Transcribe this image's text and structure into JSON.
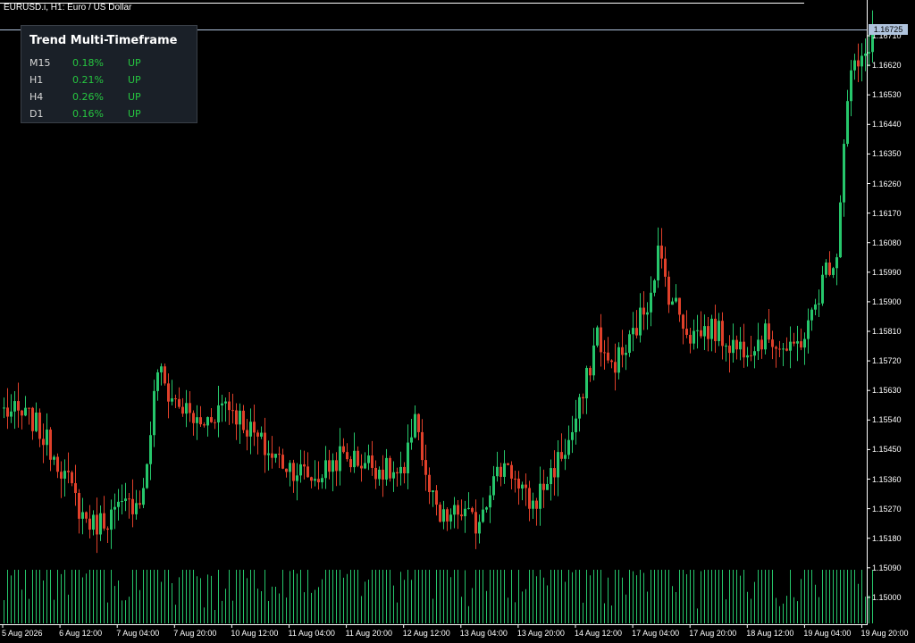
{
  "window": {
    "symbol_title": "EURUSD.i, H1:  Euro / US Dollar"
  },
  "trend_panel": {
    "title": "Trend Multi-Timeframe",
    "rows": [
      {
        "tf": "M15",
        "pct": "0.18%",
        "dir": "UP"
      },
      {
        "tf": "H1",
        "pct": "0.21%",
        "dir": "UP"
      },
      {
        "tf": "H4",
        "pct": "0.26%",
        "dir": "UP"
      },
      {
        "tf": "D1",
        "pct": "0.16%",
        "dir": "UP"
      }
    ]
  },
  "price_axis": {
    "labels": [
      "1.16710",
      "1.16620",
      "1.16530",
      "1.16440",
      "1.16350",
      "1.16260",
      "1.16170",
      "1.16080",
      "1.15990",
      "1.15900",
      "1.15810",
      "1.15720",
      "1.15630",
      "1.15540",
      "1.15450",
      "1.15360",
      "1.15270",
      "1.15180",
      "1.15090",
      "1.15000"
    ],
    "bid_label": "1.16725"
  },
  "time_axis": {
    "labels": [
      "5 Aug 2026",
      "6 Aug 12:00",
      "7 Aug 04:00",
      "7 Aug 20:00",
      "10 Aug 12:00",
      "11 Aug 04:00",
      "11 Aug 20:00",
      "12 Aug 12:00",
      "13 Aug 04:00",
      "13 Aug 20:00",
      "14 Aug 12:00",
      "17 Aug 04:00",
      "17 Aug 20:00",
      "18 Aug 12:00",
      "19 Aug 04:00",
      "19 Aug 20:00"
    ]
  },
  "colors": {
    "bull": "#26c66b",
    "bear": "#e0402a",
    "volume": "#26c66b",
    "bid_line": "#b0c4de",
    "text": "#ffffff",
    "up_text": "#26c640"
  },
  "chart_data": {
    "type": "candlestick",
    "symbol": "EURUSD.i",
    "timeframe": "H1",
    "ylim": [
      1.149,
      1.168
    ],
    "anchors": [
      {
        "bar": 0,
        "price": 1.1557
      },
      {
        "bar": 8,
        "price": 1.1554
      },
      {
        "bar": 15,
        "price": 1.1542
      },
      {
        "bar": 22,
        "price": 1.1525
      },
      {
        "bar": 25,
        "price": 1.1522
      },
      {
        "bar": 35,
        "price": 1.1528
      },
      {
        "bar": 39,
        "price": 1.1532
      },
      {
        "bar": 43,
        "price": 1.157
      },
      {
        "bar": 46,
        "price": 1.1562
      },
      {
        "bar": 55,
        "price": 1.1552
      },
      {
        "bar": 62,
        "price": 1.156
      },
      {
        "bar": 68,
        "price": 1.1552
      },
      {
        "bar": 74,
        "price": 1.1544
      },
      {
        "bar": 80,
        "price": 1.154
      },
      {
        "bar": 87,
        "price": 1.1536
      },
      {
        "bar": 94,
        "price": 1.1543
      },
      {
        "bar": 102,
        "price": 1.1541
      },
      {
        "bar": 112,
        "price": 1.1536
      },
      {
        "bar": 115,
        "price": 1.1558
      },
      {
        "bar": 118,
        "price": 1.1535
      },
      {
        "bar": 122,
        "price": 1.1523
      },
      {
        "bar": 128,
        "price": 1.1526
      },
      {
        "bar": 132,
        "price": 1.1522
      },
      {
        "bar": 136,
        "price": 1.1534
      },
      {
        "bar": 141,
        "price": 1.1542
      },
      {
        "bar": 144,
        "price": 1.1532
      },
      {
        "bar": 148,
        "price": 1.1528
      },
      {
        "bar": 152,
        "price": 1.1536
      },
      {
        "bar": 158,
        "price": 1.1547
      },
      {
        "bar": 162,
        "price": 1.1561
      },
      {
        "bar": 166,
        "price": 1.1581
      },
      {
        "bar": 169,
        "price": 1.157
      },
      {
        "bar": 174,
        "price": 1.1575
      },
      {
        "bar": 180,
        "price": 1.159
      },
      {
        "bar": 183,
        "price": 1.1605
      },
      {
        "bar": 186,
        "price": 1.1593
      },
      {
        "bar": 192,
        "price": 1.158
      },
      {
        "bar": 198,
        "price": 1.1582
      },
      {
        "bar": 205,
        "price": 1.1576
      },
      {
        "bar": 210,
        "price": 1.1578
      },
      {
        "bar": 214,
        "price": 1.158
      },
      {
        "bar": 220,
        "price": 1.1574
      },
      {
        "bar": 225,
        "price": 1.1582
      },
      {
        "bar": 230,
        "price": 1.16
      },
      {
        "bar": 233,
        "price": 1.1605
      },
      {
        "bar": 235,
        "price": 1.164
      },
      {
        "bar": 237,
        "price": 1.166
      },
      {
        "bar": 240,
        "price": 1.1662
      },
      {
        "bar": 242,
        "price": 1.1669
      },
      {
        "bar": 243,
        "price": 1.1672
      }
    ]
  }
}
